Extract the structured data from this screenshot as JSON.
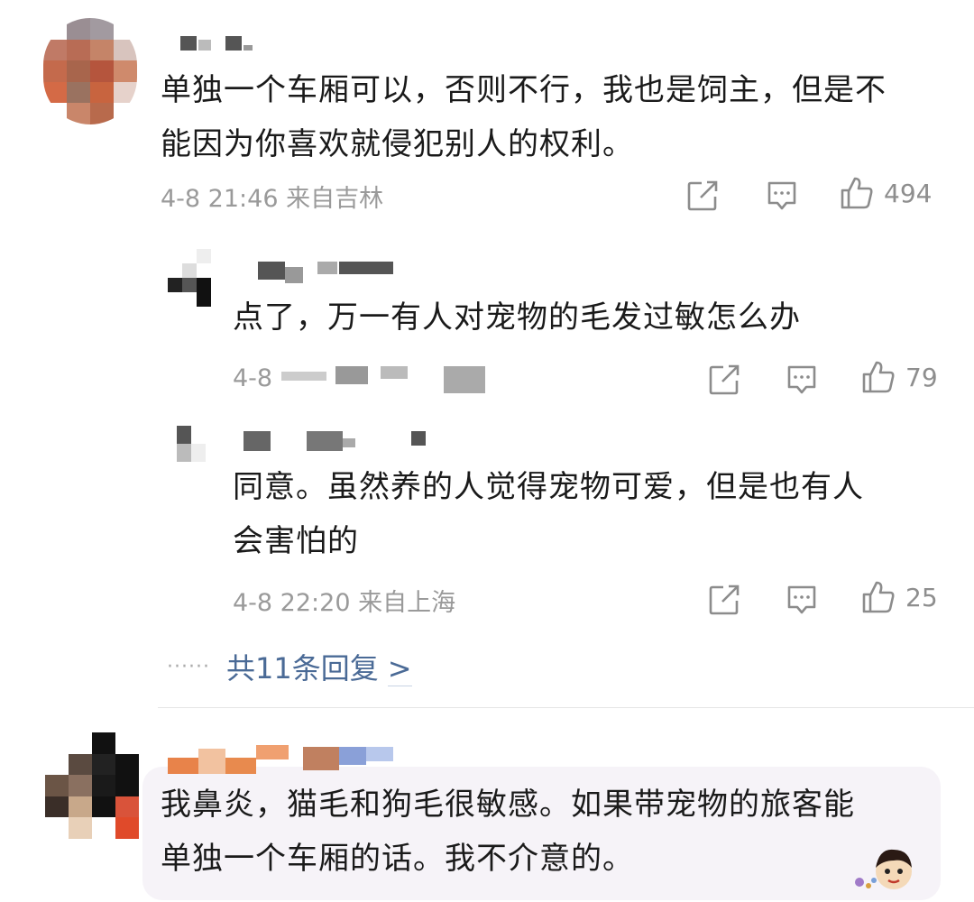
{
  "comments": [
    {
      "text_line1": "单独一个车厢可以，否则不行，我也是饲主，但是不",
      "text_line2": "能因为你喜欢就侵犯别人的权利。",
      "meta": "4-8 21:46  来自吉林",
      "likes": "494"
    },
    {
      "text": "点了，万一有人对宠物的毛发过敏怎么办",
      "meta": "4-8",
      "likes": "79"
    },
    {
      "text_line1": "同意。虽然养的人觉得宠物可爱，但是也有人",
      "text_line2": "会害怕的",
      "meta": "4-8 22:20  来自上海",
      "likes": "25"
    },
    {
      "text_line1": "我鼻炎，猫毛和狗毛很敏感。如果带宠物的旅客能",
      "text_line2": "单独一个车厢的话。我不介意的。"
    }
  ],
  "replies": {
    "dots": "······",
    "label": "共11条回复",
    "chevron": ">"
  },
  "icons": {
    "share": "share-icon",
    "comment": "comment-icon",
    "like": "thumbs-up-icon"
  },
  "colors": {
    "link": "#4a6a96",
    "meta": "#9a9a9a",
    "icon": "#8c8c8c"
  }
}
